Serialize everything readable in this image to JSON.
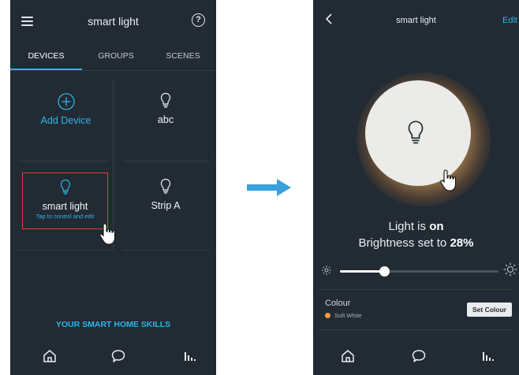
{
  "left_screen": {
    "title": "smart light",
    "tabs": [
      {
        "label": "DEVICES",
        "active": true
      },
      {
        "label": "GROUPS",
        "active": false
      },
      {
        "label": "SCENES",
        "active": false
      }
    ],
    "devices": {
      "add_label": "Add Device",
      "abc_label": "abc",
      "smart_light_label": "smart light",
      "smart_light_hint": "Tap to control and edit",
      "strip_label": "Strip A"
    },
    "skills_link": "YOUR SMART HOME SKILLS",
    "bottom_nav": [
      "home-icon",
      "chat-icon",
      "stats-icon"
    ]
  },
  "right_screen": {
    "title": "smart light",
    "edit_label": "Edit",
    "status_prefix": "Light is ",
    "status_value": "on",
    "brightness_prefix": "Brightness set to ",
    "brightness_value": "28%",
    "brightness_fraction": 0.28,
    "colour_label": "Colour",
    "colour_value": "Soft White",
    "set_colour_label": "Set Colour",
    "bottom_nav": [
      "home-icon",
      "chat-icon",
      "stats-icon"
    ]
  },
  "colors": {
    "background": "#222b33",
    "accent": "#2cb5e8",
    "highlight_box": "#e2402f",
    "soft_white_dot": "#f29a4a",
    "arrow": "#3aa1dc"
  }
}
